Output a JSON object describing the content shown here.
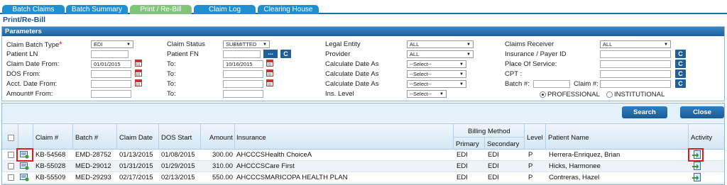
{
  "tabs": [
    {
      "label": "Batch Claims"
    },
    {
      "label": "Batch Summary"
    },
    {
      "label": "Print / Re-Bill"
    },
    {
      "label": "Claim Log"
    },
    {
      "label": "Clearing House"
    }
  ],
  "page_title": "Print/Re-Bill",
  "params": {
    "header": "Parameters",
    "claim_batch_type": {
      "label": "Claim Batch Type",
      "value": "EDI"
    },
    "patient_ln": {
      "label": "Patient LN",
      "value": ""
    },
    "claim_date_from": {
      "label": "Claim Date From:",
      "value": "01/01/2015"
    },
    "dos_from": {
      "label": "DOS From:",
      "value": ""
    },
    "acct_date_from": {
      "label": "Acct. Date From:",
      "value": ""
    },
    "amount_from": {
      "label": "Amount# From:",
      "value": ""
    },
    "claim_status": {
      "label": "Claim Status",
      "value": "SUBMITTED"
    },
    "patient_fn": {
      "label": "Patient FN",
      "value": ""
    },
    "to_label": "To:",
    "claim_date_to": "10/16/2015",
    "legal_entity": {
      "label": "Legal Entity",
      "value": "ALL"
    },
    "provider": {
      "label": "Provider",
      "value": "ALL"
    },
    "calc_date_as": {
      "label": "Calculate Date As",
      "value": "--Select--"
    },
    "ins_level": {
      "label": "Ins. Level",
      "value": "--Select--"
    },
    "claims_receiver": {
      "label": "Claims Receiver",
      "value": "ALL"
    },
    "insurance_payer": {
      "label": "Insurance / Payer ID",
      "value": ""
    },
    "place_of_service": {
      "label": "Place Of Service:",
      "value": ""
    },
    "cpt": {
      "label": "CPT :",
      "value": ""
    },
    "batch_no": {
      "label": "Batch #:",
      "value": ""
    },
    "claim_no": {
      "label": "Claim #:",
      "value": ""
    },
    "radio_professional": "PROFESSIONAL",
    "radio_institutional": "INSTITUTIONAL",
    "c_label": "C",
    "dots_label": "..."
  },
  "buttons": {
    "search": "Search",
    "close": "Close"
  },
  "table": {
    "headers": {
      "claim": "Claim #",
      "batch": "Batch #",
      "claim_date": "Claim Date",
      "dos_start": "DOS Start",
      "amount": "Amount",
      "insurance": "Insurance",
      "billing_method": "Billing Method",
      "primary": "Primary",
      "secondary": "Secondary",
      "level": "Level",
      "patient": "Patient Name",
      "activity": "Activity"
    },
    "rows": [
      {
        "claim": "KB-54568",
        "batch": "EMD-28752",
        "claim_date": "01/13/2015",
        "dos": "01/08/2015",
        "amount": "300.00",
        "insurance": "AHCCCSHealth ChoiceA",
        "primary": "EDI",
        "secondary": "EDI",
        "level": "P",
        "patient": "Herrera-Enriquez, Brian"
      },
      {
        "claim": "KB-55028",
        "batch": "MED-29012",
        "claim_date": "01/31/2015",
        "dos": "01/29/2015",
        "amount": "310.00",
        "insurance": "AHCCCSCare First",
        "primary": "EDI",
        "secondary": "EDI",
        "level": "P",
        "patient": "Hicks, Harmonee"
      },
      {
        "claim": "KB-55509",
        "batch": "MED-29293",
        "claim_date": "02/17/2015",
        "dos": "02/13/2015",
        "amount": "550.00",
        "insurance": "AHCCCSMARICOPA HEALTH PLAN",
        "primary": "EDI",
        "secondary": "EDI",
        "level": "P",
        "patient": "Contreras, Hazel"
      }
    ]
  },
  "colors": {
    "tab_blue": "#1f8fd0",
    "tab_active": "#7fc57a",
    "highlight": "#e01b1b"
  }
}
